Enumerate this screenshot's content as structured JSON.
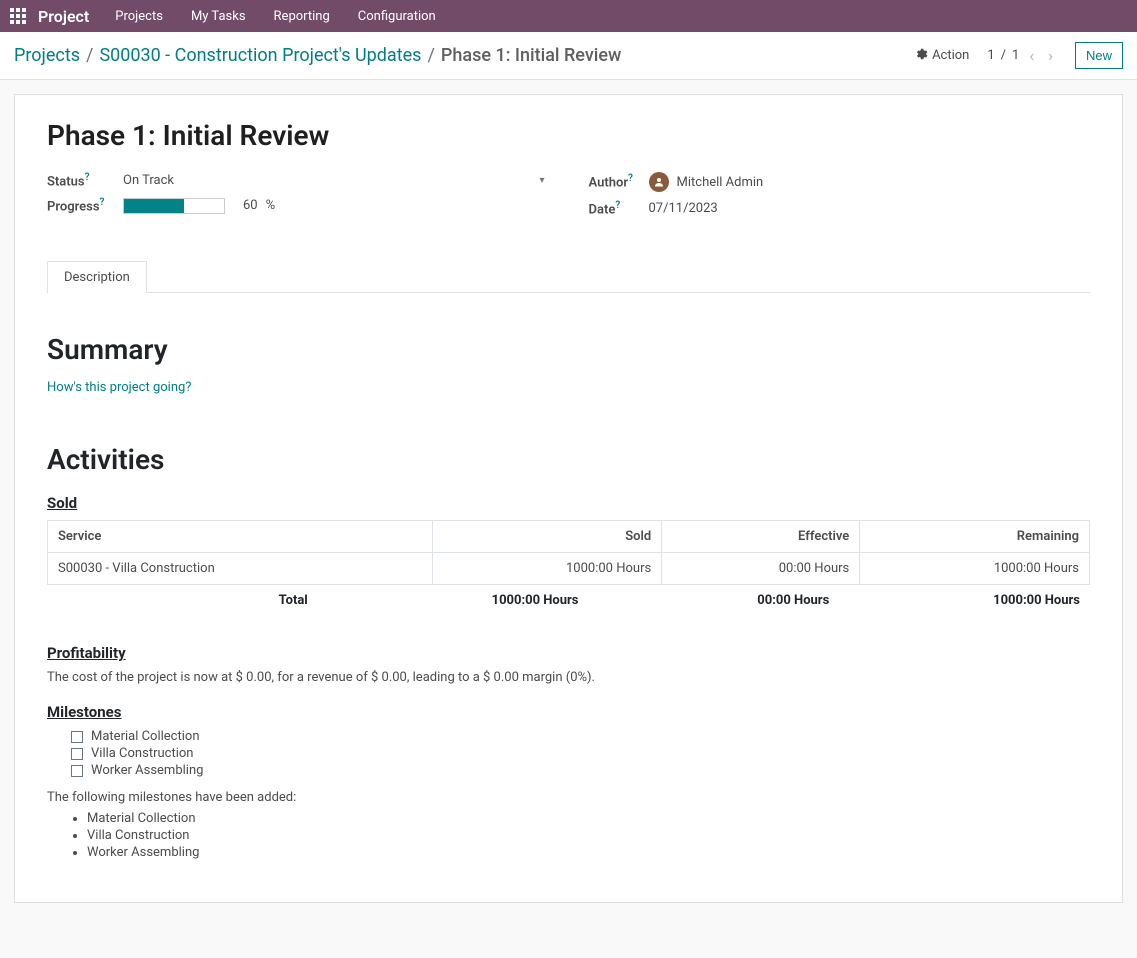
{
  "topnav": {
    "brand": "Project",
    "links": [
      "Projects",
      "My Tasks",
      "Reporting",
      "Configuration"
    ]
  },
  "breadcrumb": {
    "root": "Projects",
    "parent": "S00030 - Construction Project's Updates",
    "current": "Phase 1: Initial Review"
  },
  "actions": {
    "action_label": "Action",
    "pager_current": "1",
    "pager_total": "1",
    "new_label": "New"
  },
  "record": {
    "title": "Phase 1: Initial Review",
    "labels": {
      "status": "Status",
      "progress": "Progress",
      "author": "Author",
      "date": "Date"
    },
    "status": "On Track",
    "progress_value": 60,
    "progress_display": "60",
    "progress_unit": "%",
    "author": "Mitchell Admin",
    "date": "07/11/2023"
  },
  "tabs": {
    "description": "Description"
  },
  "description": {
    "summary_heading": "Summary",
    "summary_placeholder": "How's this project going?",
    "activities_heading": "Activities",
    "sold_heading": "Sold",
    "sold_table": {
      "headers": [
        "Service",
        "Sold",
        "Effective",
        "Remaining"
      ],
      "rows": [
        {
          "service": "S00030 - Villa Construction",
          "sold": "1000:00 Hours",
          "effective": "00:00 Hours",
          "remaining": "1000:00 Hours"
        }
      ],
      "total_label": "Total",
      "totals": {
        "sold": "1000:00 Hours",
        "effective": "00:00 Hours",
        "remaining": "1000:00 Hours"
      }
    },
    "profitability_heading": "Profitability",
    "profitability_text": "The cost of the project is now at $ 0.00, for a revenue of $ 0.00, leading to a $ 0.00 margin (0%).",
    "milestones_heading": "Milestones",
    "milestone_checks": [
      "Material Collection",
      "Villa Construction",
      "Worker Assembling"
    ],
    "milestones_added_text": "The following milestones have been added:",
    "milestones_added": [
      "Material Collection",
      "Villa Construction",
      "Worker Assembling"
    ]
  },
  "colors": {
    "brand": "#714b67",
    "accent": "#017e84"
  }
}
